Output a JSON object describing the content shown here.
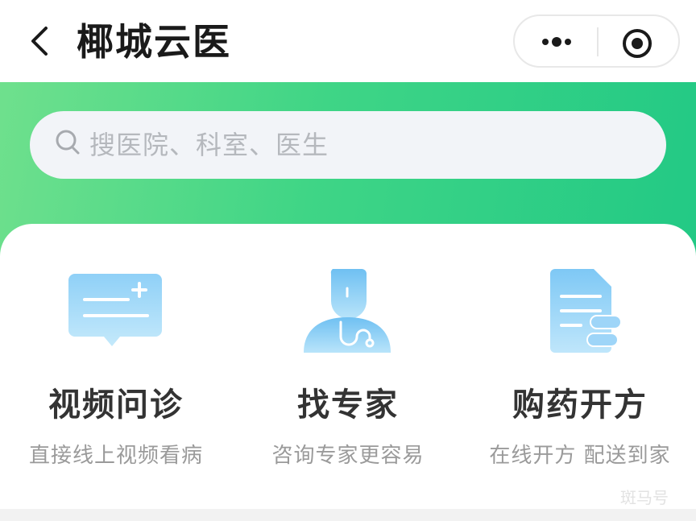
{
  "header": {
    "title": "椰城云医",
    "back_icon": "chevron-left-icon",
    "more_icon": "more-dots-icon",
    "close_icon": "target-close-icon"
  },
  "search": {
    "placeholder": "搜医院、科室、医生",
    "icon": "search-icon"
  },
  "features": [
    {
      "title": "视频问诊",
      "subtitle": "直接线上视频看病",
      "icon": "video-consult-icon"
    },
    {
      "title": "找专家",
      "subtitle": "咨询专家更容易",
      "icon": "doctor-icon"
    },
    {
      "title": "购药开方",
      "subtitle": "在线开方 配送到家",
      "icon": "prescription-icon"
    }
  ],
  "watermark": "斑马号",
  "colors": {
    "accent_green": "#3fd586",
    "icon_blue": "#7cc6f4",
    "title_text": "#333333",
    "sub_text": "#9a9a9a"
  }
}
